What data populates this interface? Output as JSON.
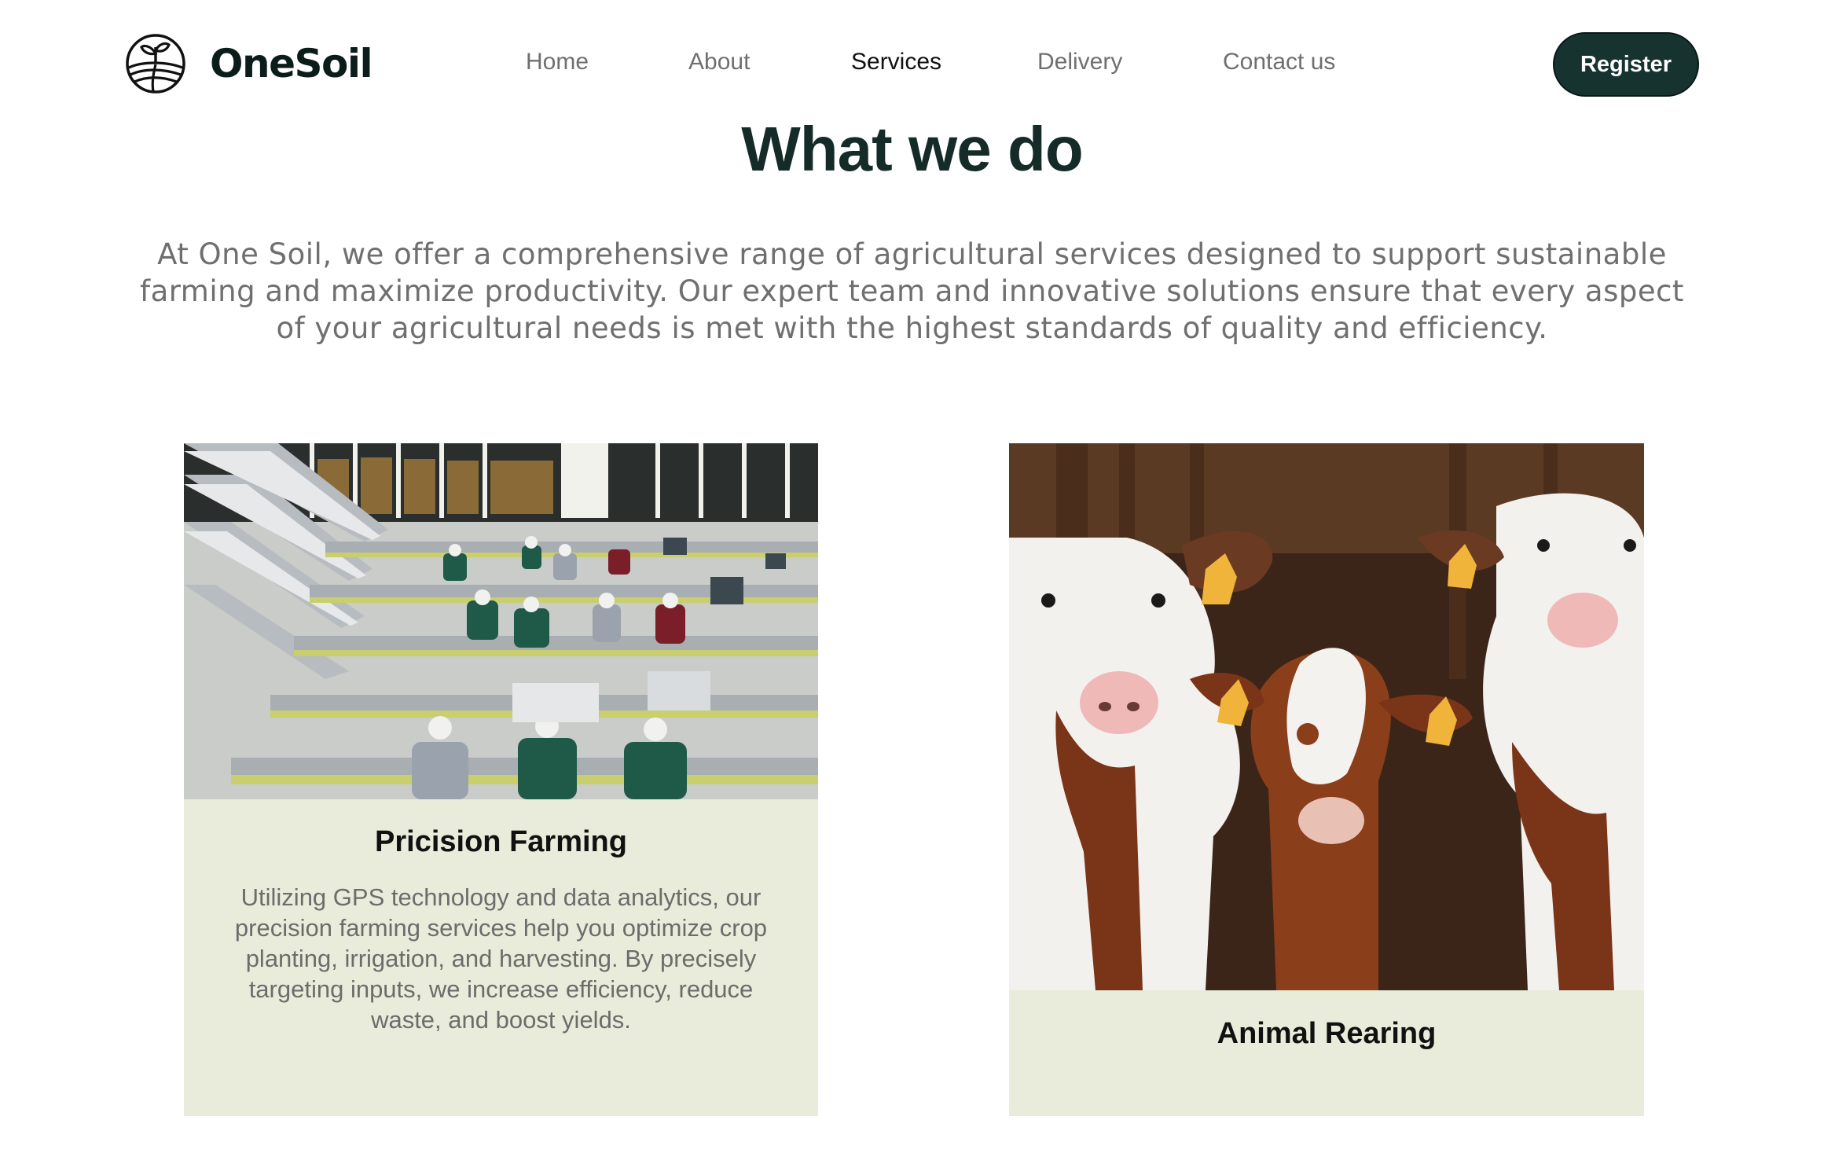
{
  "brand": {
    "name": "OneSoil",
    "logo_icon": "sprout-field-icon"
  },
  "nav": {
    "items": [
      {
        "label": "Home",
        "active": false
      },
      {
        "label": "About",
        "active": false
      },
      {
        "label": "Services",
        "active": true
      },
      {
        "label": "Delivery",
        "active": false
      },
      {
        "label": "Contact us",
        "active": false
      }
    ]
  },
  "header": {
    "register_label": "Register"
  },
  "hero": {
    "title": "What we do",
    "intro": "At One Soil, we offer a comprehensive range of agricultural services designed to support sustainable farming and maximize productivity. Our expert team and innovative solutions ensure that every aspect of your agricultural needs is met with the highest standards of quality and efficiency."
  },
  "services": [
    {
      "title": "Pricision Farming",
      "description": "Utilizing GPS technology and data analytics, our precision farming services help you optimize crop planting, irrigation, and harvesting. By precisely targeting inputs, we increase efficiency, reduce waste, and boost yields.",
      "image": "processing-facility-photo"
    },
    {
      "title": "Animal Rearing",
      "description": "",
      "image": "cows-photo"
    }
  ],
  "colors": {
    "primary_dark": "#163330",
    "card_bg": "#e9ecda",
    "nav_text": "#6f6f6f",
    "heading": "#142b28"
  }
}
